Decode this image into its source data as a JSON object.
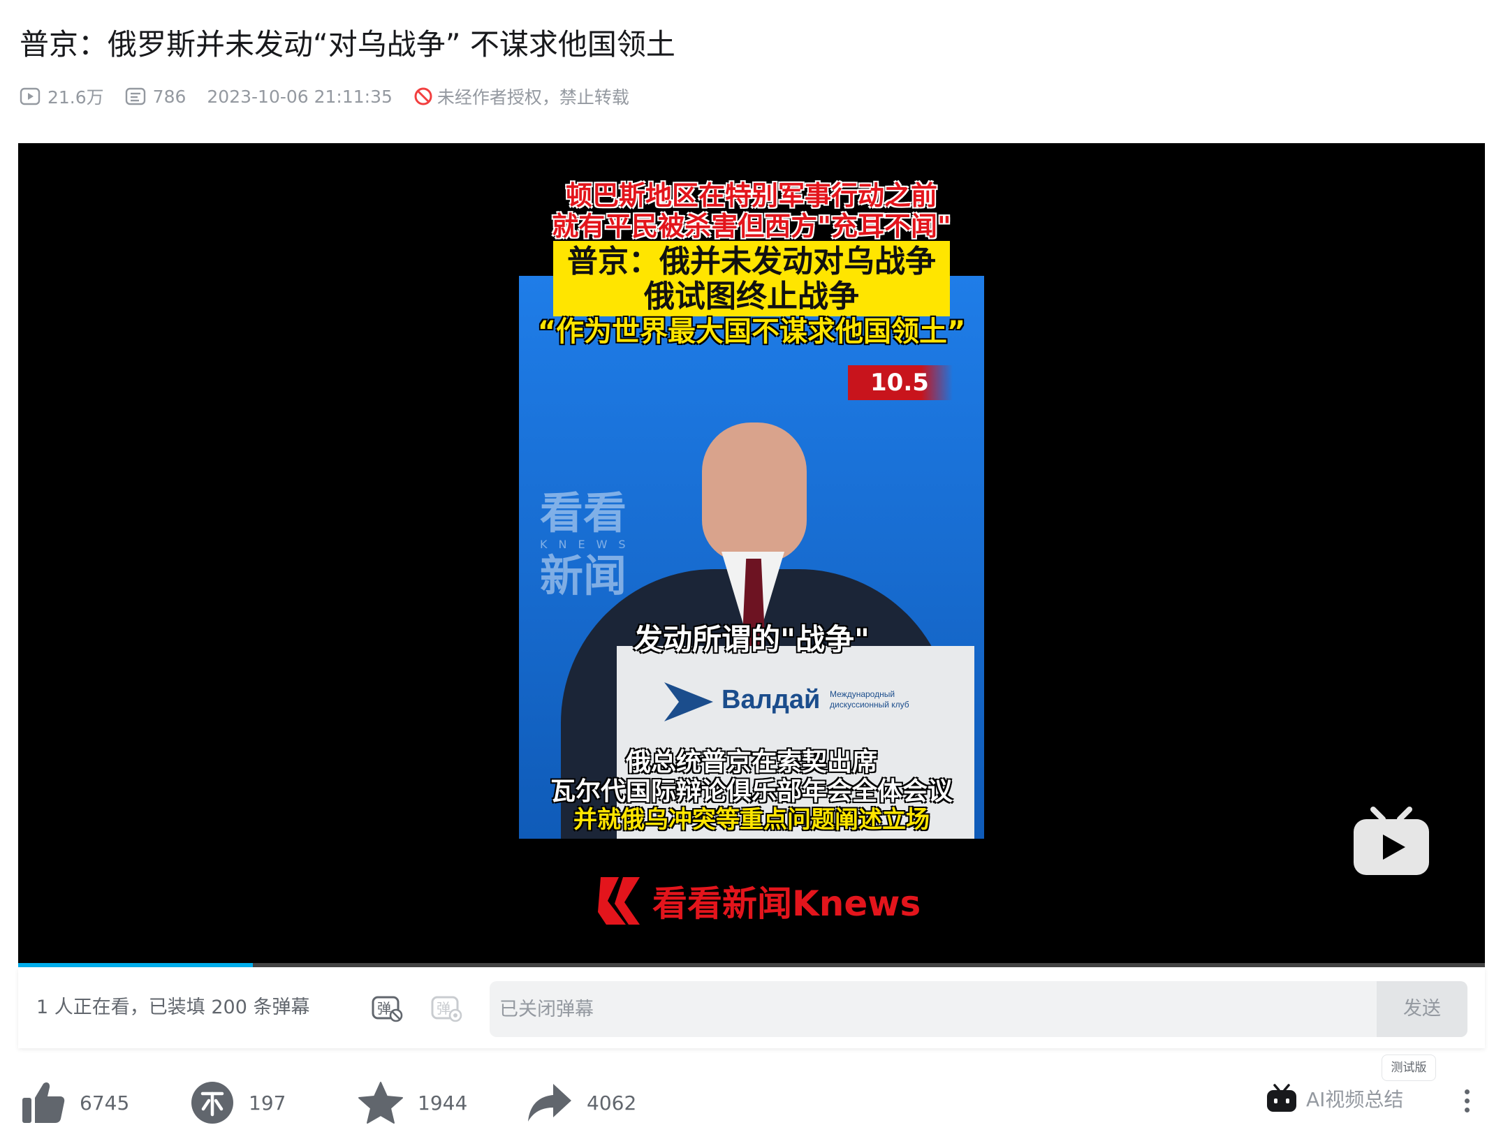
{
  "video": {
    "title": "普京：俄罗斯并未发动“对乌战争” 不谋求他国领土",
    "views": "21.6万",
    "danmaku_count": "786",
    "publish_time": "2023-10-06 21:11:35",
    "copyright_notice": "未经作者授权，禁止转载"
  },
  "player": {
    "caption_red_line1": "顿巴斯地区在特别军事行动之前",
    "caption_red_line2": "就有平民被杀害但西方\"充耳不闻\"",
    "caption_black_line1": "普京：俄并未发动对乌战争",
    "caption_black_line2": "俄试图终止战争",
    "caption_yellow_quote": "“作为世界最大国不谋求他国领土”",
    "date_badge": "10.5",
    "watermark_line1": "看看",
    "watermark_knews": "KNEWS",
    "watermark_line2": "新闻",
    "podium_brand": "Валдай",
    "podium_sub": "Международный дискуссионный клуб",
    "subtitle_spoken": "发动所谓的\"战争\"",
    "subtitle_bottom_line1": "俄总统普京在索契出席",
    "subtitle_bottom_line2": "瓦尔代国际辩论俱乐部年会全体会议",
    "subtitle_bottom_line3": "并就俄乌冲突等重点问题阐述立场",
    "brand_logo_text": "看看新闻Knews",
    "progress": 0.16
  },
  "danmaku_bar": {
    "viewers_text": "1 人正在看，已装填 200 条弹幕",
    "input_placeholder": "已关闭弹幕",
    "send_label": "发送"
  },
  "actions": {
    "like_count": "6745",
    "coin_count": "197",
    "favorite_count": "1944",
    "share_count": "4062",
    "test_badge": "测试版",
    "ai_summary_label": "AI视频总结"
  },
  "colors": {
    "accent": "#00aeec",
    "text_secondary": "#61666d",
    "text_muted": "#9499a0",
    "caption_red": "#e3151c",
    "caption_yellow": "#ffe500"
  }
}
